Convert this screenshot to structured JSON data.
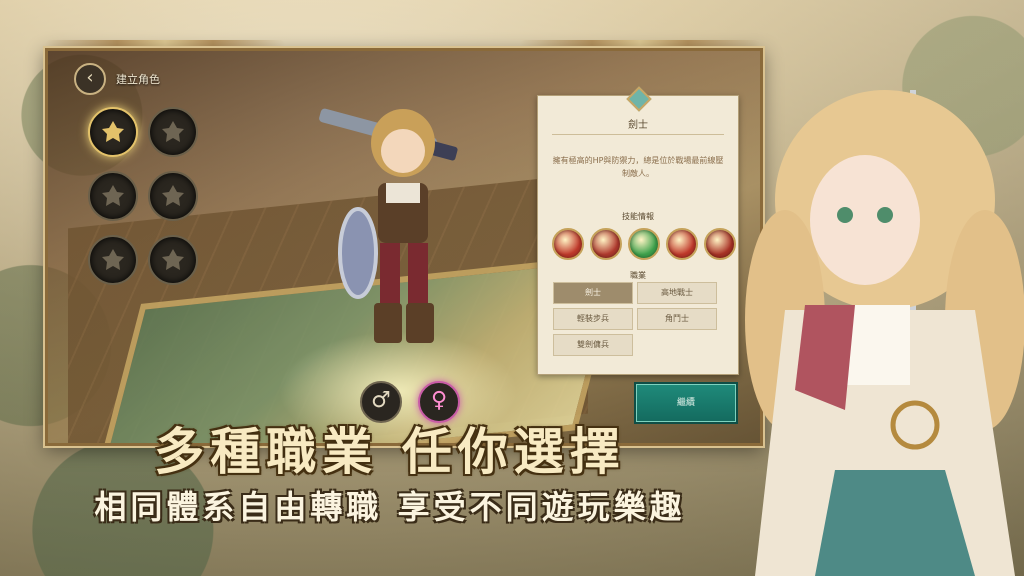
{
  "header": {
    "back_icon": "chevron-left-icon",
    "title": "建立角色"
  },
  "classes": [
    {
      "name": "class-warrior",
      "icon": "crest-icon",
      "active": true
    },
    {
      "name": "class-2",
      "icon": "crest-icon",
      "active": false
    },
    {
      "name": "class-3",
      "icon": "crest-icon",
      "active": false
    },
    {
      "name": "class-4",
      "icon": "crest-icon",
      "active": false
    },
    {
      "name": "class-5",
      "icon": "crest-icon",
      "active": false
    },
    {
      "name": "class-6",
      "icon": "crest-icon",
      "active": false
    }
  ],
  "gender": {
    "male_symbol": "♂",
    "female_symbol": "♀",
    "selected": "female"
  },
  "info": {
    "class_name": "劍士",
    "description": "擁有極高的HP與防禦力，總是位於戰場最前線壓制敵人。",
    "skills_title": "技能情報",
    "skill_colors": [
      "#c0392b",
      "#b03a2e",
      "#3fa34d",
      "#c0392b",
      "#a93226"
    ],
    "jobs_title": "職業",
    "jobs": [
      "劍士",
      "高地戰士",
      "輕裝步兵",
      "角鬥士",
      "雙劍傭兵"
    ],
    "selected_job": "劍士"
  },
  "continue_label": "繼續",
  "slogan": {
    "main": "多種職業 任你選擇",
    "sub": "相同體系自由轉職 享受不同遊玩樂趣"
  },
  "colors": {
    "accent": "#1f8a7a",
    "gold": "#e3c26a"
  }
}
